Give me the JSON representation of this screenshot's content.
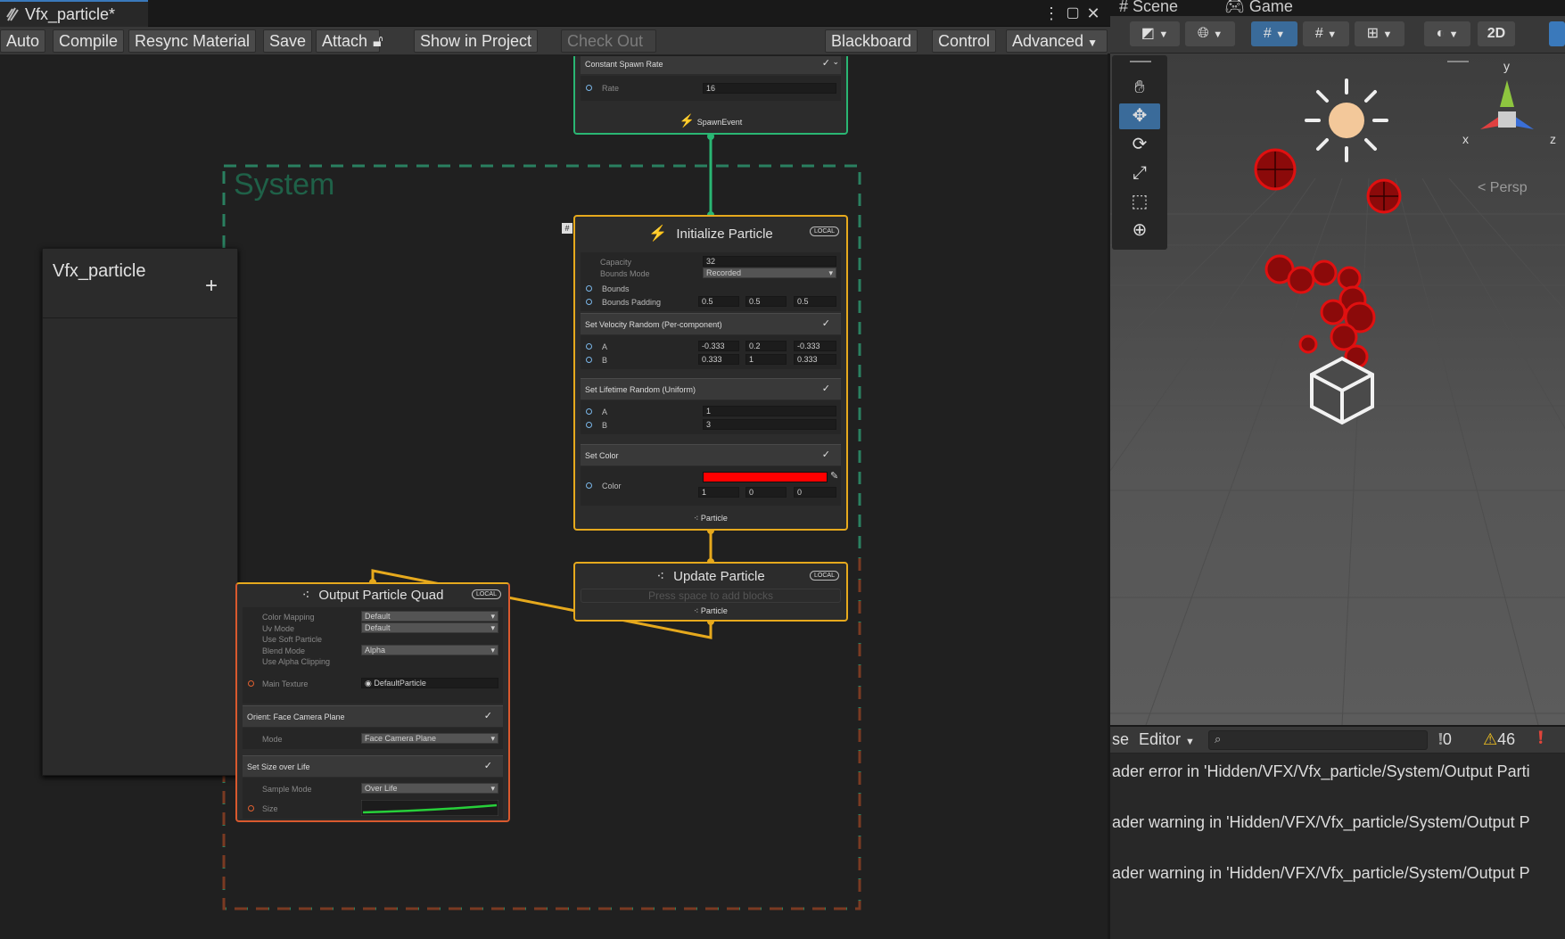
{
  "tab": {
    "title": "Vfx_particle*"
  },
  "window": {
    "menu_icon": "kebab-menu-icon",
    "maximize_icon": "maximize-icon",
    "close_icon": "close-icon"
  },
  "toolbar": {
    "auto": "Auto",
    "compile": "Compile",
    "resync": "Resync Material",
    "save": "Save",
    "attach": "Attach",
    "show_in_project": "Show in Project",
    "check_out": "Check Out",
    "blackboard": "Blackboard",
    "control": "Control",
    "advanced": "Advanced"
  },
  "blackboard": {
    "title": "Vfx_particle",
    "add": "+"
  },
  "system": {
    "label": "System"
  },
  "spawn": {
    "block": "Constant Spawn Rate",
    "rate_label": "Rate",
    "rate": "16",
    "footer": "SpawnEvent"
  },
  "init": {
    "title": "Initialize Particle",
    "local": "LOCAL",
    "capacity_label": "Capacity",
    "capacity": "32",
    "bounds_mode_label": "Bounds Mode",
    "bounds_mode": "Recorded",
    "bounds_label": "Bounds",
    "bounds_padding_label": "Bounds Padding",
    "padding": {
      "x": "0.5",
      "y": "0.5",
      "z": "0.5"
    },
    "velocity_block": "Set Velocity Random (Per-component)",
    "vel_a": {
      "label": "A",
      "x": "-0.333",
      "y": "0.2",
      "z": "-0.333"
    },
    "vel_b": {
      "label": "B",
      "x": "0.333",
      "y": "1",
      "z": "0.333"
    },
    "lifetime_block": "Set Lifetime Random (Uniform)",
    "life_a": {
      "label": "A",
      "value": "1"
    },
    "life_b": {
      "label": "B",
      "value": "3"
    },
    "color_block": "Set Color",
    "color_label": "Color",
    "color_hex": "#ff0000",
    "color_xyz": {
      "x": "1",
      "y": "0",
      "z": "0"
    },
    "footer": "Particle"
  },
  "update": {
    "title": "Update Particle",
    "local": "LOCAL",
    "placeholder": "Press space to add blocks",
    "footer": "Particle"
  },
  "output": {
    "title": "Output Particle Quad",
    "local": "LOCAL",
    "color_mapping_label": "Color Mapping",
    "color_mapping": "Default",
    "uv_mode_label": "Uv Mode",
    "uv_mode": "Default",
    "soft_particle_label": "Use Soft Particle",
    "blend_mode_label": "Blend Mode",
    "blend_mode": "Alpha",
    "alpha_clip_label": "Use Alpha Clipping",
    "main_texture_label": "Main Texture",
    "main_texture": "DefaultParticle",
    "orient_block": "Orient: Face Camera Plane",
    "mode_label": "Mode",
    "mode": "Face Camera Plane",
    "size_block": "Set Size over Life",
    "sample_mode_label": "Sample Mode",
    "sample_mode": "Over Life",
    "size_label": "Size"
  },
  "scene": {
    "tab_scene": "Scene",
    "tab_game": "Game",
    "btn_2d": "2D",
    "persp": "Persp",
    "axis_x": "x",
    "axis_y": "y",
    "axis_z": "z"
  },
  "console": {
    "clear_tail": "se",
    "editor": "Editor",
    "count_info": "0",
    "count_warn": "46",
    "lines": [
      "ader error in 'Hidden/VFX/Vfx_particle/System/Output Parti",
      "ader warning in 'Hidden/VFX/Vfx_particle/System/Output P",
      "ader warning in 'Hidden/VFX/Vfx_particle/System/Output P"
    ]
  },
  "colors": {
    "spawn": "#2ab673",
    "init": "#e6a91d",
    "output": "#d9592e",
    "accent": "#3a79bb"
  }
}
